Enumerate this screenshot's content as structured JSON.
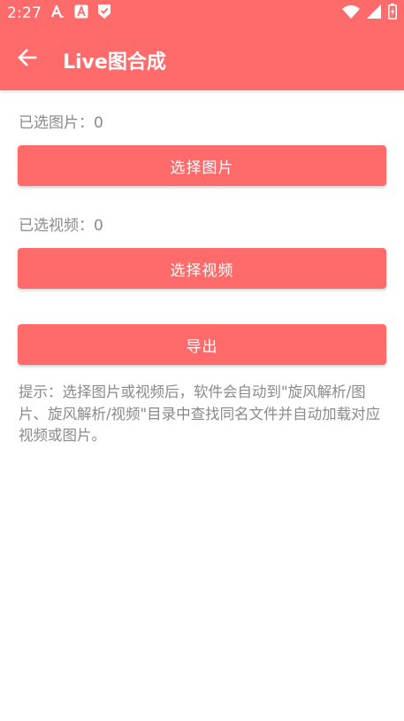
{
  "status_bar": {
    "time": "2:27",
    "left_icons": [
      "a-translate-icon",
      "a-box-icon",
      "shield-check-icon"
    ],
    "right_icons": [
      "wifi-icon",
      "signal-icon",
      "battery-charging-icon"
    ]
  },
  "toolbar": {
    "title": "Live图合成",
    "back_icon": "arrow-left-icon"
  },
  "content": {
    "selected_images_label": "已选图片：0",
    "select_images_button": "选择图片",
    "selected_videos_label": "已选视频：0",
    "select_videos_button": "选择视频",
    "export_button": "导出",
    "hint": "提示：选择图片或视频后，软件会自动到\"旋风解析/图片、旋风解析/视频\"目录中查找同名文件并自动加载对应视频或图片。"
  },
  "colors": {
    "primary": "#ff6b6b",
    "text_secondary": "#8a8a8a",
    "on_primary": "#ffffff",
    "background": "#ffffff"
  }
}
